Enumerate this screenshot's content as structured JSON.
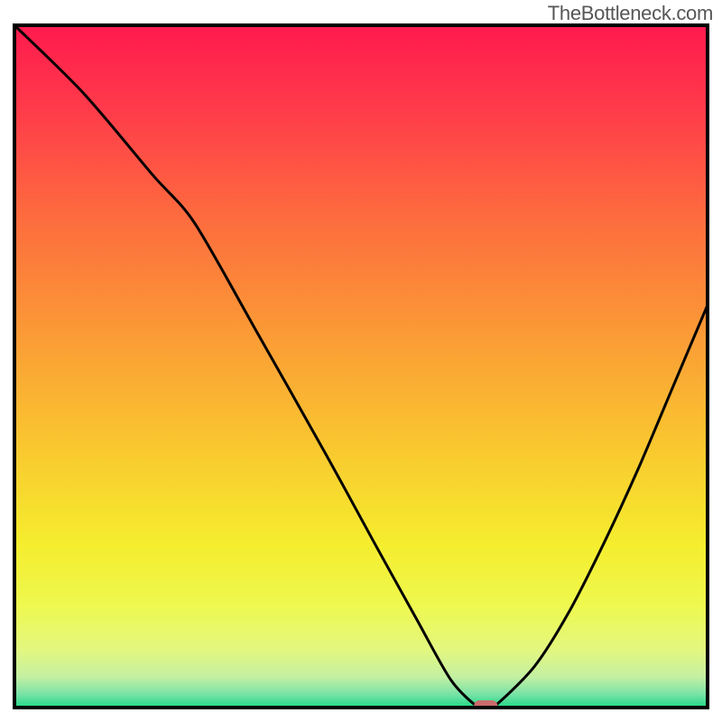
{
  "watermark": "TheBottleneck.com",
  "chart_data": {
    "type": "line",
    "title": "",
    "xlabel": "",
    "ylabel": "",
    "xlim": [
      0,
      100
    ],
    "ylim": [
      0,
      100
    ],
    "grid": false,
    "legend": false,
    "series": [
      {
        "name": "bottleneck-curve",
        "x": [
          0,
          10,
          20,
          26,
          35,
          45,
          52,
          58,
          63,
          67,
          69,
          75,
          80,
          85,
          90,
          95,
          100
        ],
        "values": [
          100,
          90,
          78,
          71,
          55,
          37,
          24,
          13,
          4,
          0,
          0,
          6,
          14,
          24,
          35,
          47,
          59
        ]
      }
    ],
    "marker": {
      "name": "optimal-point",
      "x": 68,
      "y": 0
    },
    "background_gradient": {
      "description": "vertical gradient from red (top) through orange/yellow to green (bottom)",
      "stops": [
        {
          "pos": 0.0,
          "color": "#ff1a4e"
        },
        {
          "pos": 0.12,
          "color": "#ff3a4a"
        },
        {
          "pos": 0.28,
          "color": "#fd6b3e"
        },
        {
          "pos": 0.45,
          "color": "#fb9a36"
        },
        {
          "pos": 0.62,
          "color": "#f9c82f"
        },
        {
          "pos": 0.76,
          "color": "#f5ed2e"
        },
        {
          "pos": 0.85,
          "color": "#eef84e"
        },
        {
          "pos": 0.915,
          "color": "#e3f77f"
        },
        {
          "pos": 0.955,
          "color": "#c4f0a2"
        },
        {
          "pos": 0.98,
          "color": "#7be3a7"
        },
        {
          "pos": 1.0,
          "color": "#1ed787"
        }
      ]
    }
  }
}
